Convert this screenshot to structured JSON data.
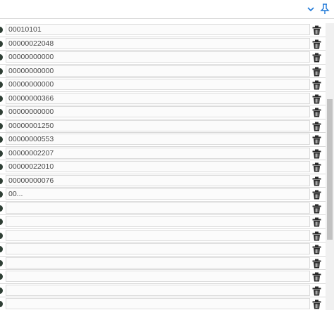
{
  "toolbar": {
    "icons": [
      "chevron-down-icon",
      "pin-icon"
    ],
    "accent_color": "#1e78d7"
  },
  "list": {
    "items": [
      {
        "value": "00010101"
      },
      {
        "value": "00000022048"
      },
      {
        "value": "00000000000"
      },
      {
        "value": "00000000000"
      },
      {
        "value": "00000000000"
      },
      {
        "value": "00000000366"
      },
      {
        "value": "00000000000"
      },
      {
        "value": "00000001250"
      },
      {
        "value": "00000000553"
      },
      {
        "value": "00000002207"
      },
      {
        "value": "00000022010"
      },
      {
        "value": "00000000076"
      },
      {
        "value": "00..."
      },
      {
        "value": ""
      },
      {
        "value": ""
      },
      {
        "value": ""
      },
      {
        "value": ""
      },
      {
        "value": ""
      },
      {
        "value": ""
      },
      {
        "value": ""
      },
      {
        "value": ""
      }
    ],
    "row_icons": [
      "bullet-icon",
      "trash-icon"
    ]
  },
  "scrollbar": {
    "position_fraction": 0.51
  }
}
